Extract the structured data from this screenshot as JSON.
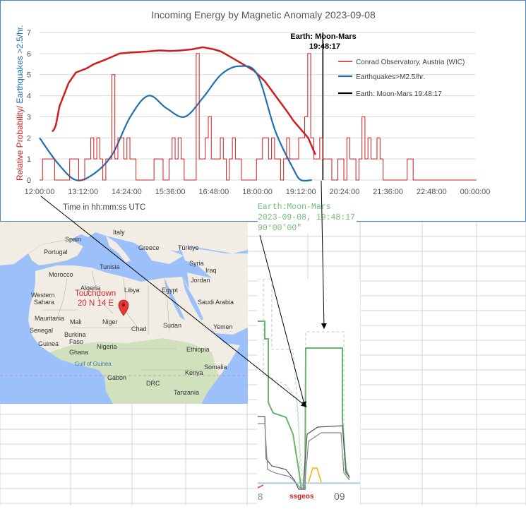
{
  "chart": {
    "title": "Incoming Energy by Magnetic Anomaly 2023-09-08",
    "ylabel_red": "Relative Probability/",
    "ylabel_blue": " Earthquakes >2.5/hr.",
    "xlabel": "Time in hh:mm:ss UTC",
    "annotation_line1": "Earth: Moon-Mars",
    "annotation_line2": "19:48:17"
  },
  "chart_data": {
    "type": "line",
    "title": "Incoming Energy by Magnetic Anomaly 2023-09-08",
    "xlabel": "Time in hh:mm:ss UTC",
    "ylabel": "Relative Probability/ Earthquakes >2.5/hr.",
    "x_ticks": [
      "12:00:00",
      "13:12:00",
      "14:24:00",
      "15:36:00",
      "16:48:00",
      "18:00:00",
      "19:12:00",
      "20:24:00",
      "21:36:00",
      "22:48:00",
      "00:00:00"
    ],
    "y_ticks": [
      0,
      1,
      2,
      3,
      4,
      5,
      6,
      7
    ],
    "xlim_hours": [
      12,
      24
    ],
    "ylim": [
      0,
      7
    ],
    "grid": true,
    "legend_position": "right",
    "series": [
      {
        "name": "Conrad Observatory, Austria (WIC)",
        "color": "#cc1f1f",
        "smooth": false,
        "x": [
          12.35,
          12.4,
          12.45,
          12.55,
          12.8,
          13.0,
          13.3,
          13.5,
          13.8,
          14.0,
          14.2,
          14.5,
          14.8,
          15.0,
          15.3,
          15.6,
          15.9,
          16.2,
          16.5,
          16.8,
          17.0,
          17.3,
          17.6,
          17.9,
          18.2,
          18.5,
          18.8,
          19.0,
          19.2,
          19.4,
          19.5,
          19.6
        ],
        "y": [
          2.3,
          2.4,
          2.6,
          3.5,
          4.6,
          5.1,
          5.3,
          5.5,
          5.7,
          5.85,
          6.0,
          6.05,
          6.08,
          6.1,
          6.15,
          6.12,
          6.15,
          6.2,
          6.3,
          6.2,
          6.1,
          5.8,
          5.5,
          5.2,
          4.7,
          4.0,
          3.3,
          2.8,
          2.4,
          2.0,
          1.6,
          1.2
        ]
      },
      {
        "name": "Earthquakes>M2.5/hr.",
        "color": "#1f6fb2",
        "smooth": true,
        "x": [
          12.0,
          12.5,
          13.0,
          13.5,
          14.0,
          14.5,
          15.0,
          15.5,
          16.0,
          16.5,
          17.0,
          17.5,
          18.0,
          18.5,
          19.0,
          19.2,
          19.5
        ],
        "y": [
          2.0,
          0.8,
          0.0,
          0.3,
          1.2,
          3.0,
          4.0,
          3.4,
          3.0,
          3.9,
          5.0,
          5.4,
          5.0,
          2.3,
          0.5,
          0.0,
          0.0
        ]
      },
      {
        "name": "Earth: Moon-Mars 19:48:17",
        "color": "#000000",
        "smooth": false,
        "x": [
          19.805,
          19.805
        ],
        "y": [
          0,
          7
        ]
      },
      {
        "name": "",
        "color": "#cc1f1f",
        "smooth": false,
        "step": true,
        "step_dx": 0.083,
        "x_start": 12.0,
        "values": [
          0,
          1,
          1,
          1,
          1,
          0,
          0,
          0,
          0,
          0,
          1,
          1,
          1,
          0,
          0,
          1,
          1,
          2,
          1,
          2,
          1,
          0,
          1,
          1,
          5,
          1,
          2,
          2,
          1,
          2,
          1,
          1,
          0,
          0,
          0,
          0,
          0,
          0,
          1,
          1,
          1,
          0,
          0,
          1,
          2,
          1,
          2,
          1,
          0,
          0,
          0,
          0,
          6,
          1,
          1,
          2,
          3,
          1,
          1,
          1,
          2,
          1,
          0,
          1,
          2,
          1,
          1,
          0,
          0,
          0,
          0,
          0,
          1,
          1,
          2,
          2,
          1,
          2,
          1,
          1,
          0,
          1,
          2,
          1,
          1,
          1,
          2,
          2,
          3,
          6,
          2,
          1,
          1,
          2,
          1,
          1,
          1,
          0,
          0,
          1,
          1,
          0,
          2,
          1,
          1,
          0,
          1,
          3,
          1,
          2,
          1,
          1,
          2,
          1,
          0,
          0,
          0,
          0,
          0,
          0,
          0,
          0,
          1,
          1,
          0,
          0,
          0,
          0,
          0,
          0,
          0,
          0,
          0,
          0,
          0,
          0,
          0,
          0,
          0,
          0,
          0,
          0,
          0,
          0,
          0
        ]
      }
    ]
  },
  "map": {
    "labels": {
      "spain": "Spain",
      "portugal": "Portugal",
      "italy": "Italy",
      "greece": "Greece",
      "turkiye": "Türkiye",
      "syria": "Syria",
      "iraq": "Iraq",
      "morocco": "Morocco",
      "tunisia": "Tunisia",
      "algeria": "Algeria",
      "libya": "Libya",
      "egypt": "Egypt",
      "jordan": "Jordan",
      "saudi": "Saudi Arabia",
      "western_sahara_1": "Western",
      "western_sahara_2": "Sahara",
      "mauritania": "Mauritania",
      "mali": "Mali",
      "niger": "Niger",
      "chad": "Chad",
      "sudan": "Sudan",
      "yemen": "Yemen",
      "burkina_1": "Burkina",
      "burkina_2": "Faso",
      "ghana": "Ghana",
      "nigeria": "Nigeria",
      "ethiopia": "Ethiopia",
      "somalia": "Somalia",
      "kenya": "Kenya",
      "gabon": "Gabon",
      "drc": "DRC",
      "tanzania": "Tanzania",
      "guinea": "Guinea",
      "gulf_of_guinea": "Gulf of Guinea",
      "senegal": "Senegal"
    },
    "touchdown_line1": "Touchdown",
    "touchdown_line2": "20 N 14 E"
  },
  "inset": {
    "label_line1": "Earth:Moon-Mars",
    "label_line2": "2023-09-08, 19:48:17",
    "label_line3": "90°00'00\"",
    "footer_left": "8",
    "footer_mid": "ssgeos",
    "footer_right": "09"
  },
  "colors": {
    "chart_border": "#4a86c6",
    "grid": "#d9d9d9",
    "ocean": "#9cc0f9",
    "land": "#f1ede4",
    "inset_green": "#6ab56b",
    "inset_green_light": "#b9e0c6",
    "inset_label": "#6fbf7a"
  }
}
